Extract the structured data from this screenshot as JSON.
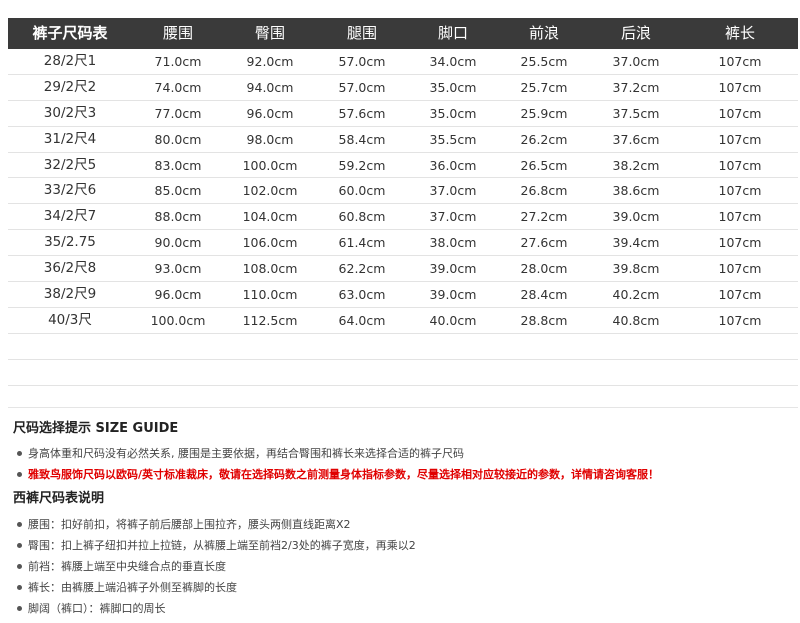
{
  "table": {
    "headers": [
      "裤子尺码表",
      "腰围",
      "臀围",
      "腿围",
      "脚口",
      "前浪",
      "后浪",
      "裤长"
    ],
    "rows": [
      [
        "28/2尺1",
        "71.0cm",
        "92.0cm",
        "57.0cm",
        "34.0cm",
        "25.5cm",
        "37.0cm",
        "107cm"
      ],
      [
        "29/2尺2",
        "74.0cm",
        "94.0cm",
        "57.0cm",
        "35.0cm",
        "25.7cm",
        "37.2cm",
        "107cm"
      ],
      [
        "30/2尺3",
        "77.0cm",
        "96.0cm",
        "57.6cm",
        "35.0cm",
        "25.9cm",
        "37.5cm",
        "107cm"
      ],
      [
        "31/2尺4",
        "80.0cm",
        "98.0cm",
        "58.4cm",
        "35.5cm",
        "26.2cm",
        "37.6cm",
        "107cm"
      ],
      [
        "32/2尺5",
        "83.0cm",
        "100.0cm",
        "59.2cm",
        "36.0cm",
        "26.5cm",
        "38.2cm",
        "107cm"
      ],
      [
        "33/2尺6",
        "85.0cm",
        "102.0cm",
        "60.0cm",
        "37.0cm",
        "26.8cm",
        "38.6cm",
        "107cm"
      ],
      [
        "34/2尺7",
        "88.0cm",
        "104.0cm",
        "60.8cm",
        "37.0cm",
        "27.2cm",
        "39.0cm",
        "107cm"
      ],
      [
        "35/2.75",
        "90.0cm",
        "106.0cm",
        "61.4cm",
        "38.0cm",
        "27.6cm",
        "39.4cm",
        "107cm"
      ],
      [
        "36/2尺8",
        "93.0cm",
        "108.0cm",
        "62.2cm",
        "39.0cm",
        "28.0cm",
        "39.8cm",
        "107cm"
      ],
      [
        "38/2尺9",
        "96.0cm",
        "110.0cm",
        "63.0cm",
        "39.0cm",
        "28.4cm",
        "40.2cm",
        "107cm"
      ],
      [
        "40/3尺",
        "100.0cm",
        "112.5cm",
        "64.0cm",
        "40.0cm",
        "28.8cm",
        "40.8cm",
        "107cm"
      ]
    ]
  },
  "guide": {
    "title": "尺码选择提示 SIZE GUIDE",
    "line1": "身高体重和尺码没有必然关系, 腰围是主要依据，再结合臀围和裤长来选择合适的裤子尺码",
    "line2": "雅致鸟服饰尺码以欧码/英寸标准裁床，敬请在选择码数之前测量身体指标参数，尽量选择相对应较接近的参数，详情请咨询客服！",
    "notes_title": "西裤尺码表说明",
    "notes": [
      "腰围：扣好前扣，将裤子前后腰部上围拉齐，腰头两侧直线距离X2",
      "臀围：扣上裤子纽扣并拉上拉链，从裤腰上端至前裆2/3处的裤子宽度，再乘以2",
      "前裆：裤腰上端至中央缝合点的垂直长度",
      "裤长：由裤腰上端沿裤子外侧至裤脚的长度",
      "脚阔（裤口）：裤脚口的周长"
    ]
  },
  "colors": {
    "header_bg": "#3a3a3a",
    "warning": "#e00000"
  }
}
